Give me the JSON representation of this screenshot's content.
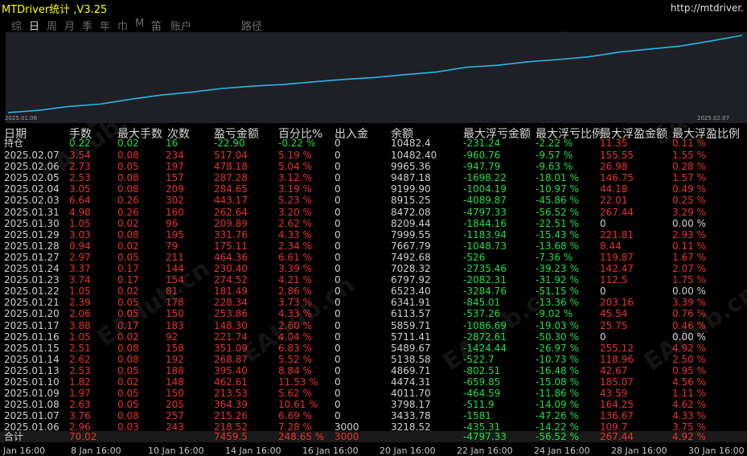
{
  "app": {
    "title": "MTDriver统计 ,V3.25",
    "url": "http://mtdriver."
  },
  "tabs": [
    "综",
    "日",
    "周",
    "月",
    "季",
    "年",
    "巾",
    "M",
    "笛",
    "账户",
    "路径"
  ],
  "active_tab": "日",
  "chart": {
    "start_label": "2025.01.06",
    "end_label": "2025.02.07",
    "line_color": "#29b6e6",
    "balance_series": [
      3218.52,
      3433.78,
      3798.17,
      4011.7,
      4474.31,
      4869.71,
      5138.58,
      5489.67,
      5711.41,
      5859.71,
      6113.57,
      6341.91,
      6523.4,
      6797.92,
      7028.32,
      7492.68,
      7667.79,
      7999.55,
      8209.44,
      8472.08,
      8915.25,
      9199.9,
      9487.18,
      9965.36,
      10482.4
    ]
  },
  "table": {
    "headers": [
      "日期",
      "手数",
      "最大手数",
      "次数",
      "盈亏金额",
      "百分比%",
      "出入金",
      "余额",
      "最大浮亏金额",
      "最大浮亏比例",
      "最大浮盈金额",
      "最大浮盈比例"
    ],
    "position_row": {
      "date": "持仓",
      "lots": "0.22",
      "max_lots": "0.02",
      "count": "16",
      "pl": "-22.90",
      "pct": "-0.22 %",
      "io": "0",
      "balance": "10482.4",
      "max_dd": "-231.24",
      "max_dd_pct": "-2.22 %",
      "max_fp": "11.35",
      "max_fp_pct": "0.11 %"
    },
    "rows": [
      {
        "date": "2025.02.07",
        "lots": "3.54",
        "max_lots": "0.08",
        "count": "234",
        "pl": "517.04",
        "pct": "5.19 %",
        "io": "0",
        "balance": "10482.40",
        "max_dd": "-960.76",
        "max_dd_pct": "-9.57 %",
        "max_fp": "155.55",
        "max_fp_pct": "1.55 %"
      },
      {
        "date": "2025.02.06",
        "lots": "2.73",
        "max_lots": "0.05",
        "count": "197",
        "pl": "478.18",
        "pct": "5.04 %",
        "io": "0",
        "balance": "9965.36",
        "max_dd": "-947.79",
        "max_dd_pct": "-9.63 %",
        "max_fp": "26.98",
        "max_fp_pct": "0.28 %"
      },
      {
        "date": "2025.02.05",
        "lots": "2.53",
        "max_lots": "0.08",
        "count": "157",
        "pl": "287.28",
        "pct": "3.12 %",
        "io": "0",
        "balance": "9487.18",
        "max_dd": "-1698.22",
        "max_dd_pct": "-18.01 %",
        "max_fp": "146.75",
        "max_fp_pct": "1.57 %"
      },
      {
        "date": "2025.02.04",
        "lots": "3.05",
        "max_lots": "0.08",
        "count": "209",
        "pl": "284.65",
        "pct": "3.19 %",
        "io": "0",
        "balance": "9199.90",
        "max_dd": "-1004.19",
        "max_dd_pct": "-10.97 %",
        "max_fp": "44.18",
        "max_fp_pct": "0.49 %"
      },
      {
        "date": "2025.02.03",
        "lots": "6.64",
        "max_lots": "0.26",
        "count": "302",
        "pl": "443.17",
        "pct": "5.23 %",
        "io": "0",
        "balance": "8915.25",
        "max_dd": "-4089.87",
        "max_dd_pct": "-45.86 %",
        "max_fp": "22.01",
        "max_fp_pct": "0.25 %"
      },
      {
        "date": "2025.01.31",
        "lots": "4.98",
        "max_lots": "0.26",
        "count": "160",
        "pl": "262.64",
        "pct": "3.20 %",
        "io": "0",
        "balance": "8472.08",
        "max_dd": "-4797.33",
        "max_dd_pct": "-56.52 %",
        "max_fp": "267.44",
        "max_fp_pct": "3.29 %"
      },
      {
        "date": "2025.01.30",
        "lots": "1.05",
        "max_lots": "0.02",
        "count": "96",
        "pl": "209.89",
        "pct": "2.62 %",
        "io": "0",
        "balance": "8209.44",
        "max_dd": "-1844.16",
        "max_dd_pct": "-22.51 %",
        "max_fp": "0",
        "max_fp_pct": "0.00 %"
      },
      {
        "date": "2025.01.29",
        "lots": "3.03",
        "max_lots": "0.08",
        "count": "195",
        "pl": "331.76",
        "pct": "4.33 %",
        "io": "0",
        "balance": "7999.55",
        "max_dd": "-1183.94",
        "max_dd_pct": "-15.43 %",
        "max_fp": "221.81",
        "max_fp_pct": "2.93 %"
      },
      {
        "date": "2025.01.28",
        "lots": "0.94",
        "max_lots": "0.02",
        "count": "79",
        "pl": "175.11",
        "pct": "2.34 %",
        "io": "0",
        "balance": "7667.79",
        "max_dd": "-1048.73",
        "max_dd_pct": "-13.68 %",
        "max_fp": "8.44",
        "max_fp_pct": "0.11 %"
      },
      {
        "date": "2025.01.27",
        "lots": "2.97",
        "max_lots": "0.05",
        "count": "211",
        "pl": "464.36",
        "pct": "6.61 %",
        "io": "0",
        "balance": "7492.68",
        "max_dd": "-526",
        "max_dd_pct": "-7.36 %",
        "max_fp": "119.87",
        "max_fp_pct": "1.67 %"
      },
      {
        "date": "2025.01.24",
        "lots": "3.37",
        "max_lots": "0.17",
        "count": "144",
        "pl": "230.40",
        "pct": "3.39 %",
        "io": "0",
        "balance": "7028.32",
        "max_dd": "-2735.46",
        "max_dd_pct": "-39.23 %",
        "max_fp": "142.47",
        "max_fp_pct": "2.07 %"
      },
      {
        "date": "2025.01.23",
        "lots": "3.74",
        "max_lots": "0.17",
        "count": "154",
        "pl": "274.52",
        "pct": "4.21 %",
        "io": "0",
        "balance": "6797.92",
        "max_dd": "-2082.31",
        "max_dd_pct": "-31.92 %",
        "max_fp": "112.5",
        "max_fp_pct": "1.75 %"
      },
      {
        "date": "2025.01.22",
        "lots": "1.05",
        "max_lots": "0.02",
        "count": "81",
        "pl": "181.49",
        "pct": "2.86 %",
        "io": "0",
        "balance": "6523.40",
        "max_dd": "-3284.76",
        "max_dd_pct": "-51.15 %",
        "max_fp": "0",
        "max_fp_pct": "0.00 %"
      },
      {
        "date": "2025.01.21",
        "lots": "2.39",
        "max_lots": "0.05",
        "count": "178",
        "pl": "228.34",
        "pct": "3.73 %",
        "io": "0",
        "balance": "6341.91",
        "max_dd": "-845.01",
        "max_dd_pct": "-13.36 %",
        "max_fp": "203.16",
        "max_fp_pct": "3.39 %"
      },
      {
        "date": "2025.01.20",
        "lots": "2.06",
        "max_lots": "0.05",
        "count": "150",
        "pl": "253.86",
        "pct": "4.33 %",
        "io": "0",
        "balance": "6113.57",
        "max_dd": "-537.26",
        "max_dd_pct": "-9.02 %",
        "max_fp": "45.54",
        "max_fp_pct": "0.76 %"
      },
      {
        "date": "2025.01.17",
        "lots": "3.88",
        "max_lots": "0.17",
        "count": "183",
        "pl": "148.30",
        "pct": "2.60 %",
        "io": "0",
        "balance": "5859.71",
        "max_dd": "-1086.69",
        "max_dd_pct": "-19.03 %",
        "max_fp": "25.75",
        "max_fp_pct": "0.46 %"
      },
      {
        "date": "2025.01.16",
        "lots": "1.05",
        "max_lots": "0.02",
        "count": "92",
        "pl": "221.74",
        "pct": "4.04 %",
        "io": "0",
        "balance": "5711.41",
        "max_dd": "-2872.61",
        "max_dd_pct": "-50.30 %",
        "max_fp": "0",
        "max_fp_pct": "0.00 %"
      },
      {
        "date": "2025.01.15",
        "lots": "2.51",
        "max_lots": "0.08",
        "count": "158",
        "pl": "351.09",
        "pct": "6.83 %",
        "io": "0",
        "balance": "5489.67",
        "max_dd": "-1424.44",
        "max_dd_pct": "-26.97 %",
        "max_fp": "255.12",
        "max_fp_pct": "4.92 %"
      },
      {
        "date": "2025.01.14",
        "lots": "2.62",
        "max_lots": "0.08",
        "count": "192",
        "pl": "268.87",
        "pct": "5.52 %",
        "io": "0",
        "balance": "5138.58",
        "max_dd": "-522.7",
        "max_dd_pct": "-10.73 %",
        "max_fp": "118.96",
        "max_fp_pct": "2.50 %"
      },
      {
        "date": "2025.01.13",
        "lots": "2.53",
        "max_lots": "0.05",
        "count": "188",
        "pl": "395.40",
        "pct": "8.84 %",
        "io": "0",
        "balance": "4869.71",
        "max_dd": "-802.51",
        "max_dd_pct": "-16.48 %",
        "max_fp": "42.67",
        "max_fp_pct": "0.95 %"
      },
      {
        "date": "2025.01.10",
        "lots": "1.82",
        "max_lots": "0.02",
        "count": "148",
        "pl": "462.61",
        "pct": "11.53 %",
        "io": "0",
        "balance": "4474.31",
        "max_dd": "-659.85",
        "max_dd_pct": "-15.08 %",
        "max_fp": "185.07",
        "max_fp_pct": "4.56 %"
      },
      {
        "date": "2025.01.09",
        "lots": "1.97",
        "max_lots": "0.05",
        "count": "150",
        "pl": "213.53",
        "pct": "5.62 %",
        "io": "0",
        "balance": "4011.70",
        "max_dd": "-464.59",
        "max_dd_pct": "-11.86 %",
        "max_fp": "43.59",
        "max_fp_pct": "1.11 %"
      },
      {
        "date": "2025.01.08",
        "lots": "2.63",
        "max_lots": "0.05",
        "count": "205",
        "pl": "364.39",
        "pct": "10.61 %",
        "io": "0",
        "balance": "3798.17",
        "max_dd": "-511.9",
        "max_dd_pct": "-14.09 %",
        "max_fp": "164.25",
        "max_fp_pct": "4.62 %"
      },
      {
        "date": "2025.01.07",
        "lots": "3.76",
        "max_lots": "0.08",
        "count": "257",
        "pl": "215.26",
        "pct": "6.69 %",
        "io": "0",
        "balance": "3433.78",
        "max_dd": "-1581",
        "max_dd_pct": "-47.26 %",
        "max_fp": "136.67",
        "max_fp_pct": "4.33 %"
      },
      {
        "date": "2025.01.06",
        "lots": "2.96",
        "max_lots": "0.03",
        "count": "243",
        "pl": "218.52",
        "pct": "7.28 %",
        "io": "3000",
        "balance": "3218.52",
        "max_dd": "-435.31",
        "max_dd_pct": "-14.22 %",
        "max_fp": "109.7",
        "max_fp_pct": "3.75 %"
      }
    ],
    "total_row": {
      "date": "合计",
      "lots": "70.02",
      "max_lots": "",
      "count": "",
      "pl": "7459.5",
      "pct": "248.65 %",
      "io": "3000",
      "balance": "",
      "max_dd": "-4797.33",
      "max_dd_pct": "-56.52 %",
      "max_fp": "267.44",
      "max_fp_pct": "4.92 %"
    }
  },
  "time_axis": [
    "Jan 16:00",
    "8 Jan 16:00",
    "10 Jan 16:00",
    "14 Jan 16:00",
    "16 Jan 16:00",
    "20 Jan 16:00",
    "22 Jan 16:00",
    "24 Jan 16:00",
    "28 Jan 16:00",
    "30 Jan 16:00"
  ],
  "watermark": "EAHub.cn"
}
